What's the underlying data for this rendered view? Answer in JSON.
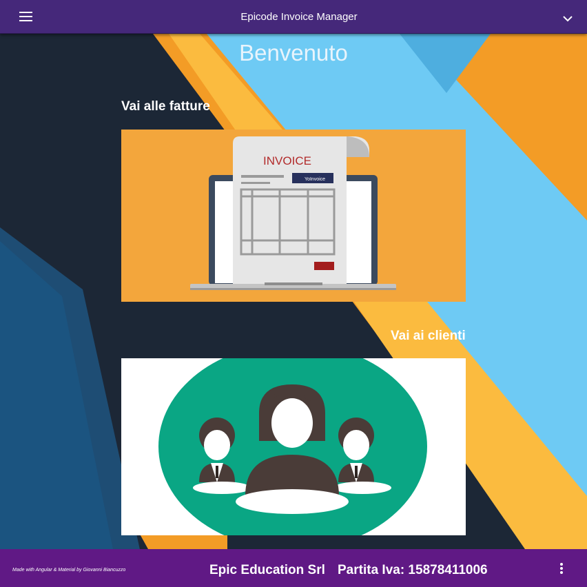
{
  "toolbar": {
    "title": "Epicode Invoice Manager",
    "menu_icon": "menu-icon",
    "expand_icon": "chevron-down-icon"
  },
  "main": {
    "heading": "Benvenuto",
    "invoices": {
      "link_label": "Vai alle fatture",
      "image_title": "INVOICE",
      "image_brand": "YoInvoice"
    },
    "clients": {
      "link_label": "Vai ai clienti",
      "image_icon": "team-people-icon"
    }
  },
  "footer": {
    "credit": "Made with Angular & Material by Giovanni Biancuzzo",
    "company": "Epic Education Srl",
    "vat": "Partita Iva: 15878411006",
    "more_icon": "more-vert-icon"
  },
  "colors": {
    "toolbar": "#45287a",
    "footer": "#601985",
    "background_dark": "#1c2736",
    "stripe_orange": "#f39c26",
    "stripe_yellow": "#fbbb3f",
    "stripe_blue": "#6ecaf4",
    "invoice_card": "#f3a63c",
    "clients_circle": "#0aa684"
  }
}
